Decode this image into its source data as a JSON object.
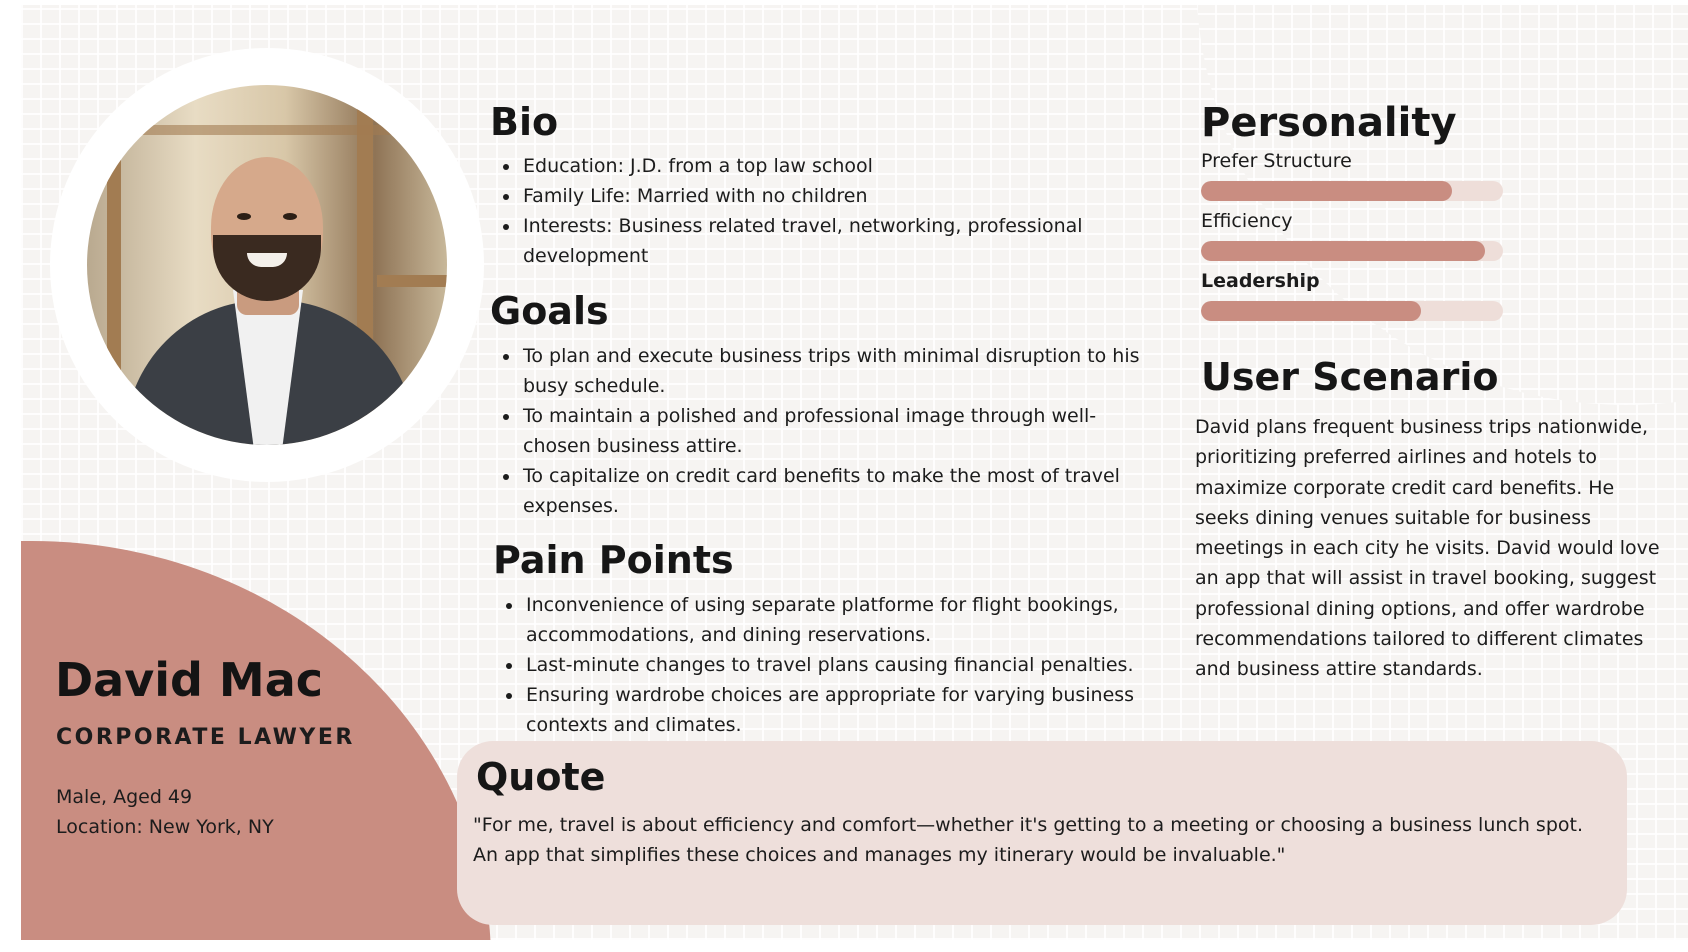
{
  "profile": {
    "name": "David Mac",
    "role": "CORPORATE LAWYER",
    "gender_age": "Male, Aged 49",
    "location": "Location: New York, NY"
  },
  "bio": {
    "title": "Bio",
    "items": [
      "Education: J.D. from a top law school",
      "Family Life: Married with no children",
      "Interests: Business related travel, networking, professional development"
    ]
  },
  "goals": {
    "title": "Goals",
    "items": [
      "To plan and execute business trips with minimal disruption to his busy schedule.",
      "To maintain a polished and professional image through well-chosen business attire.",
      "To capitalize on credit card benefits to make the most of travel expenses."
    ]
  },
  "pain_points": {
    "title": "Pain Points",
    "items": [
      "Inconvenience of using separate platforme for flight bookings, accommodations, and dining reservations.",
      "Last-minute changes to travel plans causing financial penalties.",
      "Ensuring wardrobe choices are appropriate for varying business contexts and climates."
    ]
  },
  "personality": {
    "title": "Personality",
    "traits": [
      {
        "label": "Prefer Structure",
        "level": 0.83
      },
      {
        "label": "Efficiency",
        "level": 0.94
      },
      {
        "label": "Leadership",
        "level": 0.73
      }
    ]
  },
  "scenario": {
    "title": "User Scenario",
    "text": "David plans frequent business trips nationwide, prioritizing preferred airlines and hotels to maximize corporate credit card benefits. He seeks dining venues suitable for business meetings in each city he visits. David would love an app that will assist in travel booking, suggest professional dining options, and offer wardrobe recommendations tailored to different climates and business attire standards."
  },
  "quote": {
    "title": "Quote",
    "text": "\"For me, travel is about efficiency and comfort—whether it's getting to a meeting or choosing a business lunch spot. An app that simplifies these choices and manages my itinerary would be invaluable.\""
  },
  "colors": {
    "accent": "#c98d81",
    "track": "#eeded9",
    "quote_bg": "#eedfdb"
  }
}
